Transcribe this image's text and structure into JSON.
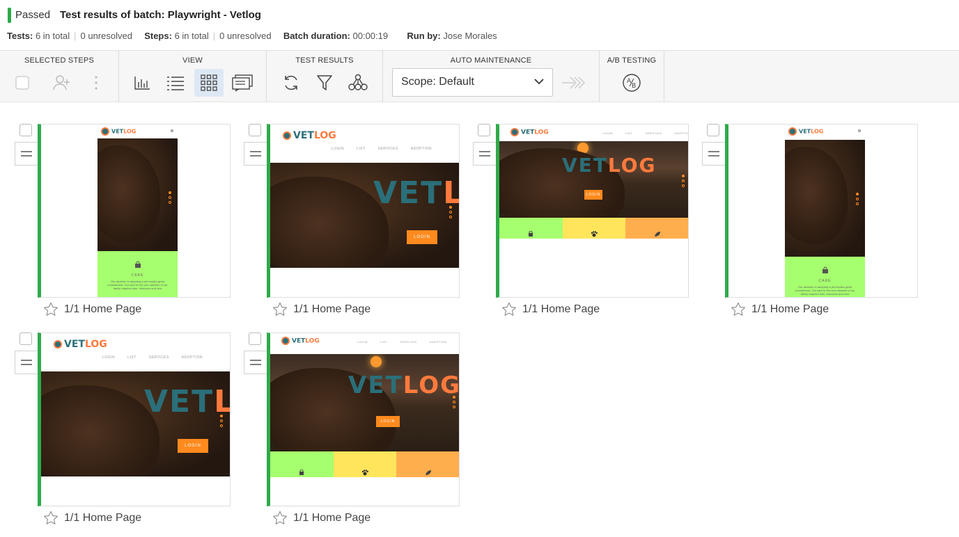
{
  "header": {
    "status": "Passed",
    "title": "Test results of batch:  Playwright - Vetlog",
    "tests_label": "Tests:",
    "tests_total": "6 in total",
    "tests_unresolved": "0 unresolved",
    "steps_label": "Steps:",
    "steps_total": "6 in total",
    "steps_unresolved": "0 unresolved",
    "duration_label": "Batch duration:",
    "duration_value": "00:00:19",
    "runby_label": "Run by:",
    "runby_value": "Jose Morales"
  },
  "toolbar": {
    "selected_steps": "SELECTED STEPS",
    "view": "VIEW",
    "test_results": "TEST RESULTS",
    "auto_maintenance": "AUTO MAINTENANCE",
    "ab_testing": "A/B TESTING",
    "scope": "Scope: Default",
    "ab_icon_text": "A/B"
  },
  "colors": {
    "passed": "#2eaa4a",
    "accent_bg": "#dde8f5",
    "orange": "#ff8a1e",
    "green": "#a6ff6e",
    "yellow": "#ffe55c",
    "amber": "#ffae4d"
  },
  "thumb_text": {
    "brand_left": "VET",
    "brand_right": "LOG",
    "hero_left": "VET",
    "hero_right_lo": "LO",
    "hero_right_log": "LOG",
    "nav_login": "LOGIN",
    "nav_list": "LIST",
    "nav_services": "SERVICES",
    "nav_adoption": "ADOPTION",
    "btn_login": "LOGIN",
    "care_title": "CARE",
    "care_body": "Our decision in adopting a pet implies great commitment. Our care to the new member of our family requires time, tolerance and love"
  },
  "steps": [
    {
      "label": "1/1 Home Page",
      "layout": "mobile"
    },
    {
      "label": "1/1 Home Page",
      "layout": "tablet"
    },
    {
      "label": "1/1 Home Page",
      "layout": "desktop"
    },
    {
      "label": "1/1 Home Page",
      "layout": "mobile2"
    },
    {
      "label": "1/1 Home Page",
      "layout": "tablet"
    },
    {
      "label": "1/1 Home Page",
      "layout": "desktop2"
    }
  ]
}
